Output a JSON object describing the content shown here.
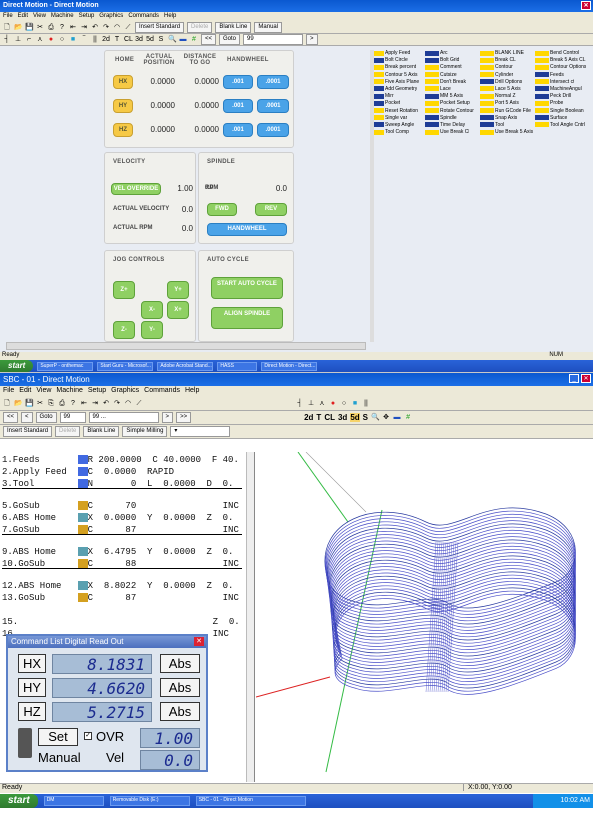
{
  "top": {
    "title": "Direct Motion - Direct Motion",
    "menu": [
      "File",
      "Edit",
      "View",
      "Machine",
      "Setup",
      "Graphics",
      "Commands",
      "Help"
    ],
    "buttons": [
      "Insert Standard",
      "Delete",
      "Blank Line",
      "Manual"
    ],
    "goto": {
      "label": "Goto",
      "value": "99"
    },
    "axes": {
      "headers": [
        "HOME",
        "ACTUAL POSITION",
        "DISTANCE TO GO",
        "HANDWHEEL"
      ],
      "rows": [
        {
          "btn": "HX",
          "actual": "0.0000",
          "dist": "0.0000",
          "h1": ".001",
          "h2": ".0001"
        },
        {
          "btn": "HY",
          "actual": "0.0000",
          "dist": "0.0000",
          "h1": ".001",
          "h2": ".0001"
        },
        {
          "btn": "HZ",
          "actual": "0.0000",
          "dist": "0.0000",
          "h1": ".001",
          "h2": ".0001"
        }
      ]
    },
    "velocity": {
      "title": "VELOCITY",
      "override": "VEL OVERRIDE",
      "override_val": "1.00",
      "actual_vel_lbl": "ACTUAL VELOCITY",
      "actual_vel": "0.0",
      "actual_rpm_lbl": "ACTUAL RPM",
      "actual_rpm": "0.0"
    },
    "spindle": {
      "title": "SPINDLE",
      "rpm_lbl": "RPM",
      "rpm": "0.0",
      "fwd": "FWD",
      "rev": "REV",
      "handwheel": "HANDWHEEL"
    },
    "jog": {
      "title": "JOG CONTROLS",
      "zp": "Z+",
      "yp": "Y+",
      "xm": "X-",
      "xp": "X+",
      "zm": "Z-",
      "ym": "Y-"
    },
    "auto": {
      "title": "AUTO CYCLE",
      "start": "START AUTO CYCLE",
      "align": "ALIGN SPINDLE"
    },
    "commands": [
      [
        {
          "t": "Apply Feed",
          "c": "#ffd700"
        },
        {
          "t": "Arc",
          "c": "#1e3c96"
        },
        {
          "t": "BLANK LINE",
          "c": "#ffd700"
        },
        {
          "t": "Bend Control",
          "c": "#ffd700"
        }
      ],
      [
        {
          "t": "Bolt Circle",
          "c": "#1e3c96"
        },
        {
          "t": "Bolt Grid",
          "c": "#1e3c96"
        },
        {
          "t": "Break CL",
          "c": "#ffd700"
        },
        {
          "t": "Break 5 Axis CL",
          "c": "#ffd700"
        }
      ],
      [
        {
          "t": "Break percent",
          "c": "#ffd700"
        },
        {
          "t": "Comment",
          "c": "#ffd700"
        },
        {
          "t": "Contour",
          "c": "#ffd700"
        },
        {
          "t": "Contour Options",
          "c": "#ffd700"
        }
      ],
      [
        {
          "t": "Contour 5 Axis",
          "c": "#ffd700"
        },
        {
          "t": "Cutsize",
          "c": "#ffd700"
        },
        {
          "t": "Cylinder",
          "c": "#ffd700"
        },
        {
          "t": "Feeds",
          "c": "#1e3c96"
        }
      ],
      [
        {
          "t": "Five Axis Plane",
          "c": "#ffd700"
        },
        {
          "t": "Don't Break",
          "c": "#ffd700"
        },
        {
          "t": "Drill Options",
          "c": "#1e3c96"
        },
        {
          "t": "Intersect ct",
          "c": "#ffd700"
        }
      ],
      [
        {
          "t": "Add Geometry",
          "c": "#1e3c96"
        },
        {
          "t": "Lace",
          "c": "#ffd700"
        },
        {
          "t": "Lace 5 Axis",
          "c": "#ffd700"
        },
        {
          "t": "MachineAngul",
          "c": "#1e3c96"
        }
      ],
      [
        {
          "t": "Mirr",
          "c": "#1e3c96"
        },
        {
          "t": "MM 5 Axis",
          "c": "#1e3c96"
        },
        {
          "t": "Normal Z",
          "c": "#ffd700"
        },
        {
          "t": "Peck Drill",
          "c": "#1e3c96"
        }
      ],
      [
        {
          "t": "Pocket",
          "c": "#1e3c96"
        },
        {
          "t": "Pocket Setup",
          "c": "#ffd700"
        },
        {
          "t": "Port 5 Axis",
          "c": "#ffd700"
        },
        {
          "t": "Probe",
          "c": "#ffd700"
        }
      ],
      [
        {
          "t": "Reset Rotation",
          "c": "#ffd700"
        },
        {
          "t": "Rotate Contour",
          "c": "#ffd700"
        },
        {
          "t": "Run GCode File",
          "c": "#ffd700"
        },
        {
          "t": "Single Boolean",
          "c": "#ffd700"
        }
      ],
      [
        {
          "t": "Single var",
          "c": "#ffd700"
        },
        {
          "t": "Spindle",
          "c": "#1e3c96"
        },
        {
          "t": "Snap Axis",
          "c": "#1e3c96"
        },
        {
          "t": "Surface",
          "c": "#1e3c96"
        }
      ],
      [
        {
          "t": "Sweep Angle",
          "c": "#1e3c96"
        },
        {
          "t": "Time Delay",
          "c": "#1e3c96"
        },
        {
          "t": "Tool",
          "c": "#1e3c96"
        },
        {
          "t": "Tool Angle Cntrl",
          "c": "#ffd700"
        }
      ],
      [
        {
          "t": "Tool Comp",
          "c": "#ffd700"
        },
        {
          "t": "Use Break Cl",
          "c": "#ffd700"
        },
        {
          "t": "Use Break 5 Axis",
          "c": "#ffd700"
        },
        {
          "t": "",
          "c": ""
        }
      ]
    ],
    "status": "Ready",
    "status_right": "NUM",
    "taskbar": {
      "start": "start",
      "items": [
        "SuperP - onthemac",
        "Start Guru - Microsof...",
        "Adobe Acrobat Stand...",
        "HASS",
        "Direct Motion - Direct..."
      ]
    }
  },
  "bot": {
    "title": "SBC - 01 - Direct Motion",
    "menu": [
      "File",
      "Edit",
      "View",
      "Machine",
      "Setup",
      "Graphics",
      "Commands",
      "Help"
    ],
    "nav": {
      "goto": "Goto",
      "goto_val": "99",
      "field": "99 ...",
      "btns": [
        "<<",
        "<",
        ">",
        ">>"
      ]
    },
    "tb2": [
      "2d",
      "T",
      "CL",
      "3d",
      "5d",
      "S"
    ],
    "buttons": [
      "Insert Standard",
      "Delete",
      "Blank Line",
      "Simple Milling"
    ],
    "program": [
      {
        "t": "1.Feeds       ",
        "i": "#4169e1",
        "r": "R 200.0000  C 40.0000  F 40."
      },
      {
        "t": "2.Apply Feed  ",
        "i": "#4169e1",
        "r": "C  0.0000  RAPID"
      },
      {
        "t": "3.Tool        ",
        "i": "#4169e1",
        "r": "N       0  L  0.0000  D  0."
      },
      {
        "t": "",
        "i": "",
        "r": ""
      },
      {
        "t": "5.GoSub       ",
        "i": "#d4a020",
        "r": "C      70                INC"
      },
      {
        "t": "6.ABS Home    ",
        "i": "#5aa0b0",
        "r": "X  0.0000  Y  0.0000  Z  0."
      },
      {
        "t": "7.GoSub       ",
        "i": "#d4a020",
        "r": "C      87                INC"
      },
      {
        "t": "",
        "i": "",
        "r": ""
      },
      {
        "t": "9.ABS Home    ",
        "i": "#5aa0b0",
        "r": "X  6.4795  Y  0.0000  Z  0."
      },
      {
        "t": "10.GoSub      ",
        "i": "#d4a020",
        "r": "C      88                INC"
      },
      {
        "t": "",
        "i": "",
        "r": ""
      },
      {
        "t": "12.ABS Home   ",
        "i": "#5aa0b0",
        "r": "X  8.8022  Y  0.0000  Z  0."
      },
      {
        "t": "13.GoSub      ",
        "i": "#d4a020",
        "r": "C      87                INC"
      },
      {
        "t": "",
        "i": "",
        "r": ""
      },
      {
        "t": "15.           ",
        "i": "",
        "r": "                         Z  0."
      },
      {
        "t": "16.           ",
        "i": "",
        "r": "                         INC"
      }
    ],
    "dro": {
      "title": "Command List Digital Read Out",
      "rows": [
        {
          "btn": "HX",
          "val": "8.1831",
          "abs": "Abs"
        },
        {
          "btn": "HY",
          "val": "4.6620",
          "abs": "Abs"
        },
        {
          "btn": "HZ",
          "val": "5.2715",
          "abs": "Abs"
        }
      ],
      "set": "Set",
      "ovr": "OVR",
      "ovr_val": "1.00",
      "manual": "Manual",
      "vel": "Vel",
      "vel_val": "0.0"
    },
    "status": "Ready",
    "coords": "X:0.00, Y:0.00",
    "taskbar": {
      "start": "start",
      "items": [
        "DM",
        "Removable Disk (E:)",
        "SBC - 01 - Direct Motion"
      ],
      "clock": "10:02 AM"
    }
  }
}
